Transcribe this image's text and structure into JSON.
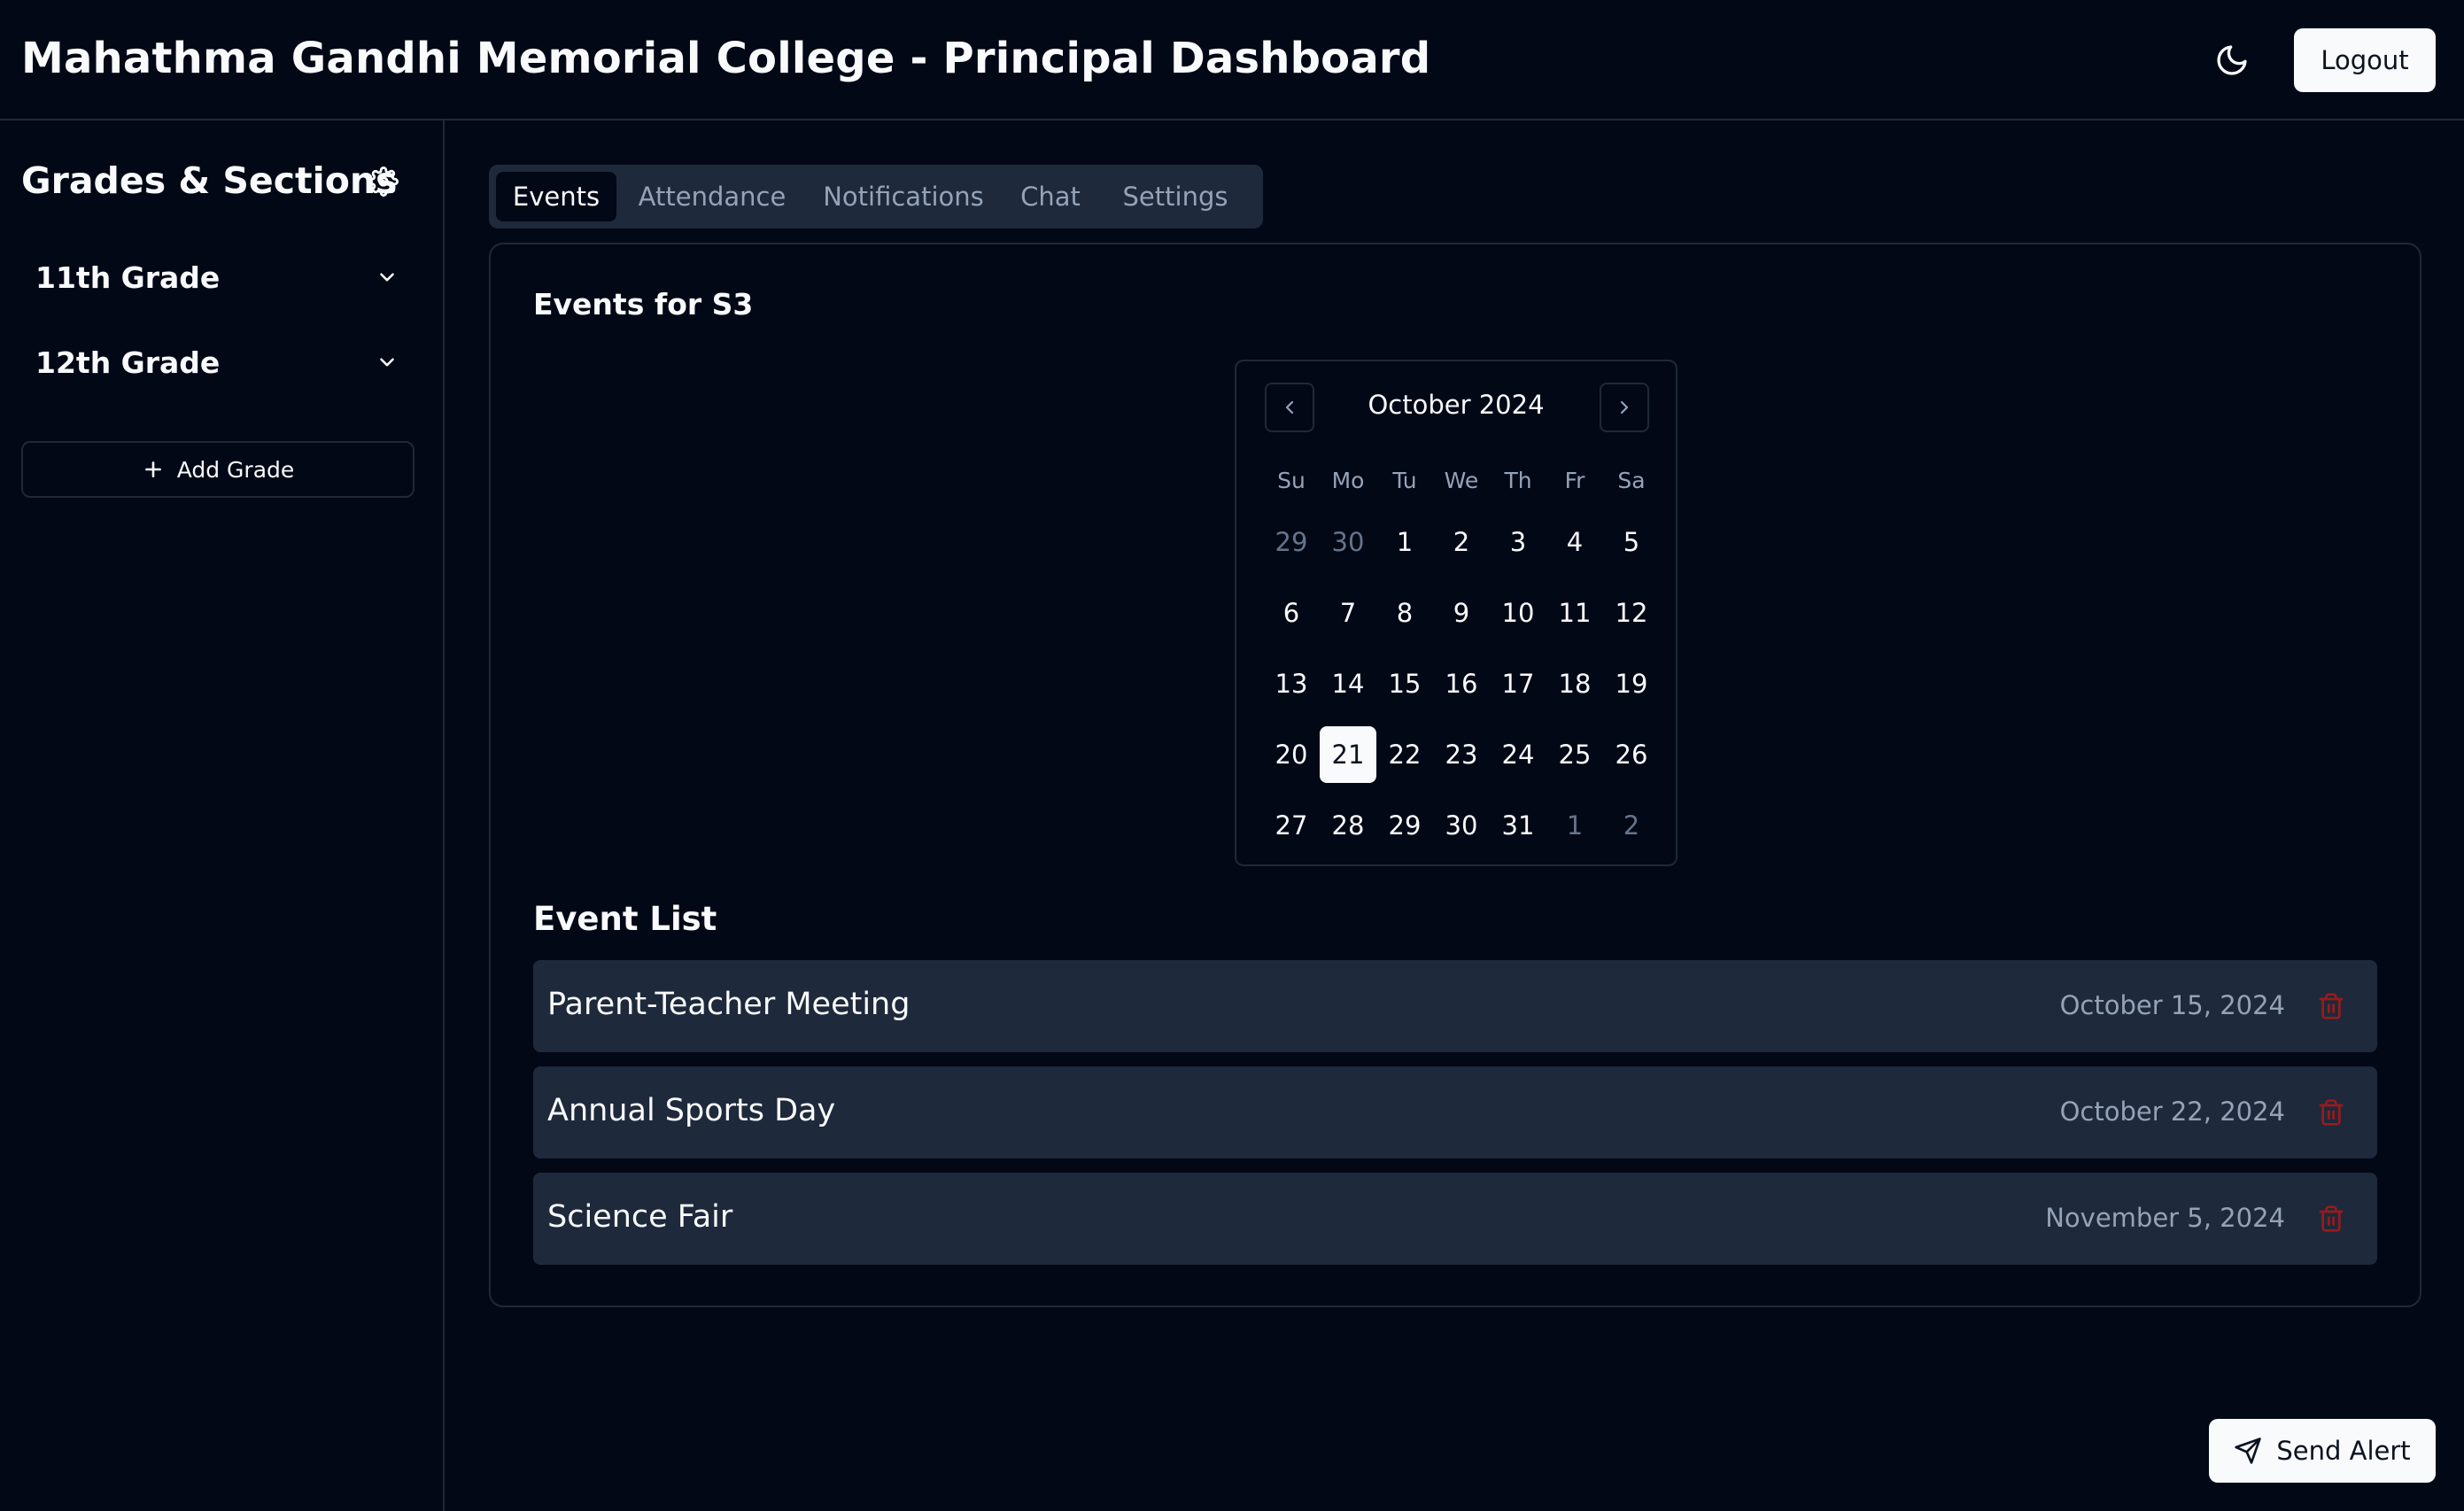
{
  "header": {
    "title": "Mahathma Gandhi Memorial College - Principal Dashboard",
    "theme_icon": "moon-icon",
    "logout_label": "Logout"
  },
  "sidebar": {
    "title": "Grades & Sections",
    "settings_icon": "gear-icon",
    "grades": [
      {
        "label": "11th Grade"
      },
      {
        "label": "12th Grade"
      }
    ],
    "add_grade_label": "Add Grade"
  },
  "tabs": [
    {
      "label": "Events",
      "active": true
    },
    {
      "label": "Attendance",
      "active": false
    },
    {
      "label": "Notifications",
      "active": false
    },
    {
      "label": "Chat",
      "active": false
    },
    {
      "label": "Settings",
      "active": false
    }
  ],
  "events_panel": {
    "title": "Events for S3",
    "calendar": {
      "month_label": "October 2024",
      "weekdays": [
        "Su",
        "Mo",
        "Tu",
        "We",
        "Th",
        "Fr",
        "Sa"
      ],
      "weeks": [
        [
          "29",
          "30",
          "1",
          "2",
          "3",
          "4",
          "5"
        ],
        [
          "6",
          "7",
          "8",
          "9",
          "10",
          "11",
          "12"
        ],
        [
          "13",
          "14",
          "15",
          "16",
          "17",
          "18",
          "19"
        ],
        [
          "20",
          "21",
          "22",
          "23",
          "24",
          "25",
          "26"
        ],
        [
          "27",
          "28",
          "29",
          "30",
          "31",
          "1",
          "2"
        ]
      ],
      "selected_day": "21"
    },
    "event_list_title": "Event List",
    "events": [
      {
        "name": "Parent-Teacher Meeting",
        "date": "October 15, 2024"
      },
      {
        "name": "Annual Sports Day",
        "date": "October 22, 2024"
      },
      {
        "name": "Science Fair",
        "date": "November 5, 2024"
      }
    ]
  },
  "send_alert_label": "Send Alert",
  "colors": {
    "background": "#030816",
    "surface": "#1e293b",
    "border": "#1f2937",
    "text": "#f8fafc",
    "muted": "#94a3b8",
    "delete": "#991b1b"
  }
}
